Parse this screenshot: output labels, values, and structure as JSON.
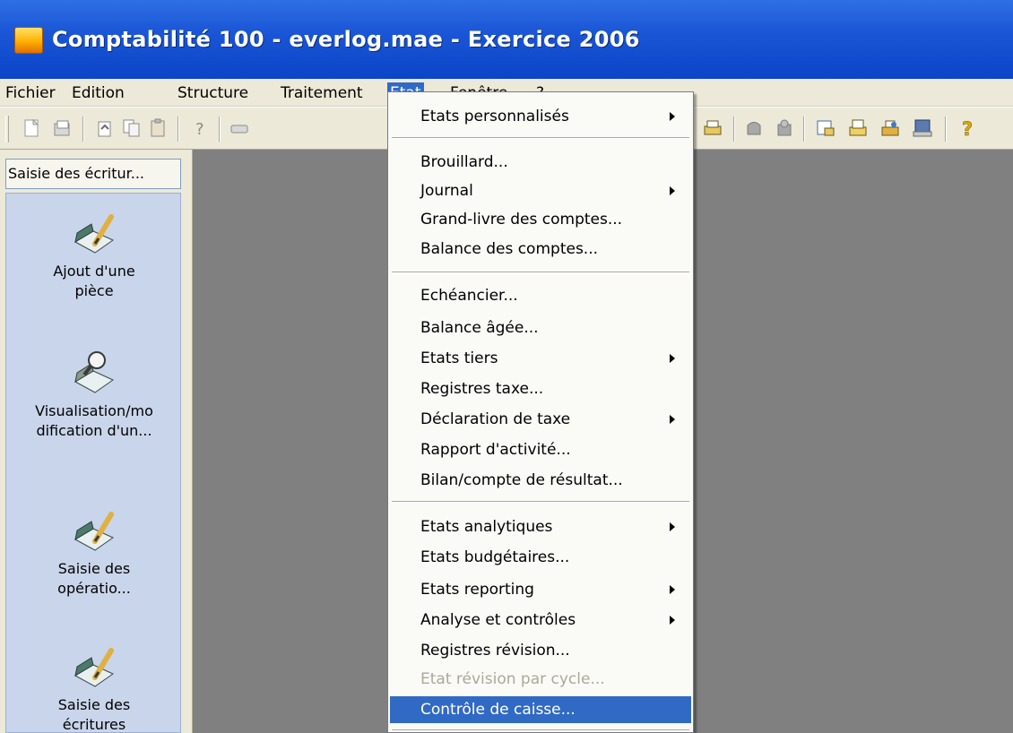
{
  "window": {
    "title": "Comptabilité 100 - everlog.mae - Exercice 2006"
  },
  "menubar": {
    "items": [
      {
        "label": "Fichier"
      },
      {
        "label": "Edition"
      },
      {
        "label": "Structure"
      },
      {
        "label": "Traitement"
      },
      {
        "label": "Etat",
        "active": true
      },
      {
        "label": "Fenêtre"
      },
      {
        "label": "?"
      }
    ]
  },
  "toolbar": {
    "icons": [
      "new-document-icon",
      "save-icon",
      "open-icon",
      "copy-icon",
      "paste-icon",
      "help-cursor-icon",
      "folder-icon",
      "window-icon",
      "printer-icon",
      "disabled-document-icon",
      "report-icon",
      "printer-doc-icon",
      "export-icon",
      "print-preview-icon",
      "help-icon"
    ]
  },
  "leftpanel": {
    "header": "Saisie des écritur...",
    "shortcuts": [
      {
        "label1": "Ajout d'une",
        "label2": "pièce",
        "icon": "add-piece-icon"
      },
      {
        "label1": "Visualisation/mo",
        "label2": "dification d'un...",
        "icon": "view-modify-icon"
      },
      {
        "label1": "Saisie des",
        "label2": "opératio...",
        "icon": "entry-operations-icon"
      },
      {
        "label1": "Saisie des",
        "label2": "écritures",
        "icon": "entry-writings-icon"
      }
    ]
  },
  "etat_menu": {
    "items": [
      {
        "label": "Etats personnalisés",
        "submenu": true
      },
      {
        "label": "Brouillard..."
      },
      {
        "label": "Journal",
        "submenu": true
      },
      {
        "label": "Grand-livre des comptes..."
      },
      {
        "label": "Balance des comptes..."
      },
      {
        "label": "Echéancier..."
      },
      {
        "label": "Balance âgée..."
      },
      {
        "label": "Etats tiers",
        "submenu": true
      },
      {
        "label": "Registres taxe..."
      },
      {
        "label": "Déclaration de taxe",
        "submenu": true
      },
      {
        "label": "Rapport d'activité..."
      },
      {
        "label": "Bilan/compte de résultat..."
      },
      {
        "label": "Etats analytiques",
        "submenu": true
      },
      {
        "label": "Etats budgétaires..."
      },
      {
        "label": "Etats reporting",
        "submenu": true
      },
      {
        "label": "Analyse et contrôles",
        "submenu": true
      },
      {
        "label": "Registres révision..."
      },
      {
        "label": "Etat révision par cycle...",
        "disabled": true
      },
      {
        "label": "Contrôle de caisse...",
        "highlighted": true
      }
    ]
  },
  "colors": {
    "titlebar": "#1b56d6",
    "menu_highlight": "#316ac5",
    "panel_bg": "#c9d5ea",
    "mdi_bg": "#808080"
  }
}
